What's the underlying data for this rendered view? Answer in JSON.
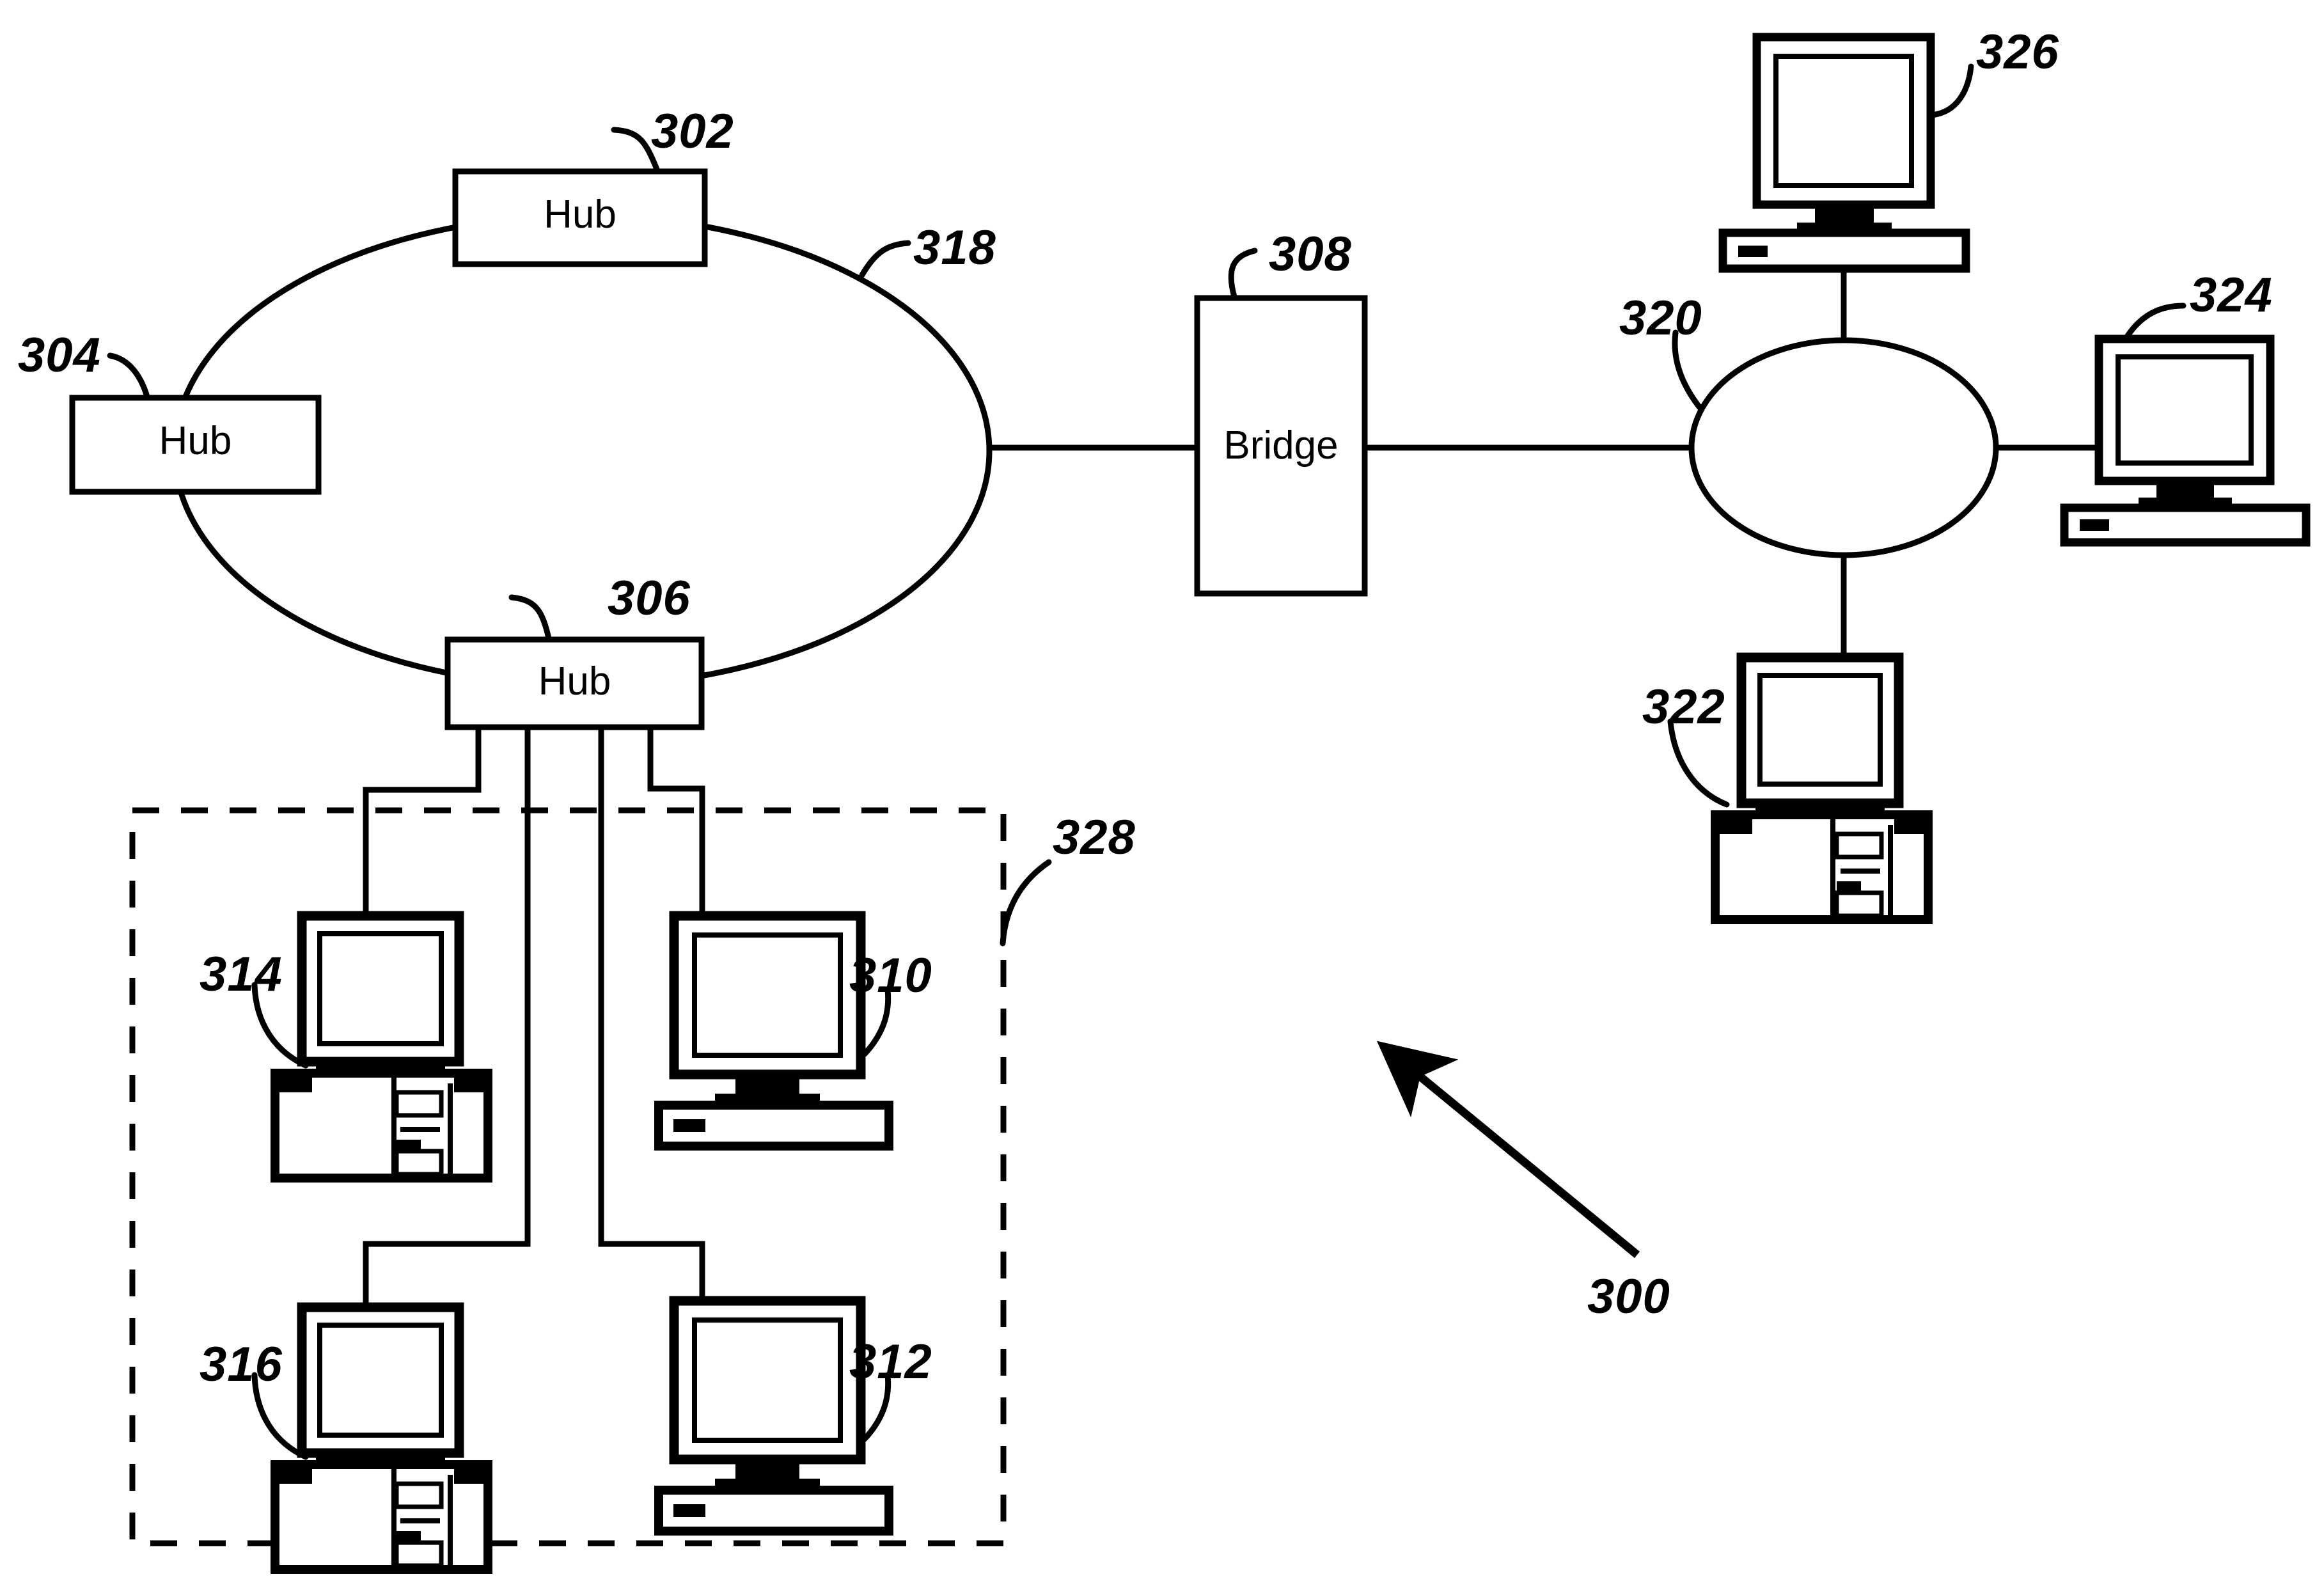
{
  "figure": {
    "type": "patent-network-diagram",
    "background_color": "#ffffff",
    "line_color": "#000000",
    "overall_reference": "300"
  },
  "nodes": {
    "hub_302": {
      "label": "Hub",
      "reference": "302"
    },
    "hub_304": {
      "label": "Hub",
      "reference": "304"
    },
    "hub_306": {
      "label": "Hub",
      "reference": "306"
    },
    "bridge_308": {
      "label": "Bridge",
      "reference": "308"
    }
  },
  "networks": {
    "left_ring": {
      "reference": "318"
    },
    "right_ring": {
      "reference": "320"
    },
    "dashed_group": {
      "reference": "328"
    }
  },
  "computers": {
    "c310": {
      "reference": "310",
      "style": "monitor-on-base"
    },
    "c312": {
      "reference": "312",
      "style": "monitor-on-base"
    },
    "c314": {
      "reference": "314",
      "style": "monitor-on-desktop-tower"
    },
    "c316": {
      "reference": "316",
      "style": "monitor-on-desktop-tower"
    },
    "c322": {
      "reference": "322",
      "style": "monitor-on-desktop-tower"
    },
    "c324": {
      "reference": "324",
      "style": "monitor-on-base"
    },
    "c326": {
      "reference": "326",
      "style": "monitor-on-base"
    }
  },
  "callouts": [
    {
      "id": "ref-302",
      "text": "302"
    },
    {
      "id": "ref-304",
      "text": "304"
    },
    {
      "id": "ref-306",
      "text": "306"
    },
    {
      "id": "ref-308",
      "text": "308"
    },
    {
      "id": "ref-310",
      "text": "310"
    },
    {
      "id": "ref-312",
      "text": "312"
    },
    {
      "id": "ref-314",
      "text": "314"
    },
    {
      "id": "ref-316",
      "text": "316"
    },
    {
      "id": "ref-318",
      "text": "318"
    },
    {
      "id": "ref-320",
      "text": "320"
    },
    {
      "id": "ref-322",
      "text": "322"
    },
    {
      "id": "ref-324",
      "text": "324"
    },
    {
      "id": "ref-326",
      "text": "326"
    },
    {
      "id": "ref-328",
      "text": "328"
    },
    {
      "id": "ref-300",
      "text": "300"
    }
  ]
}
